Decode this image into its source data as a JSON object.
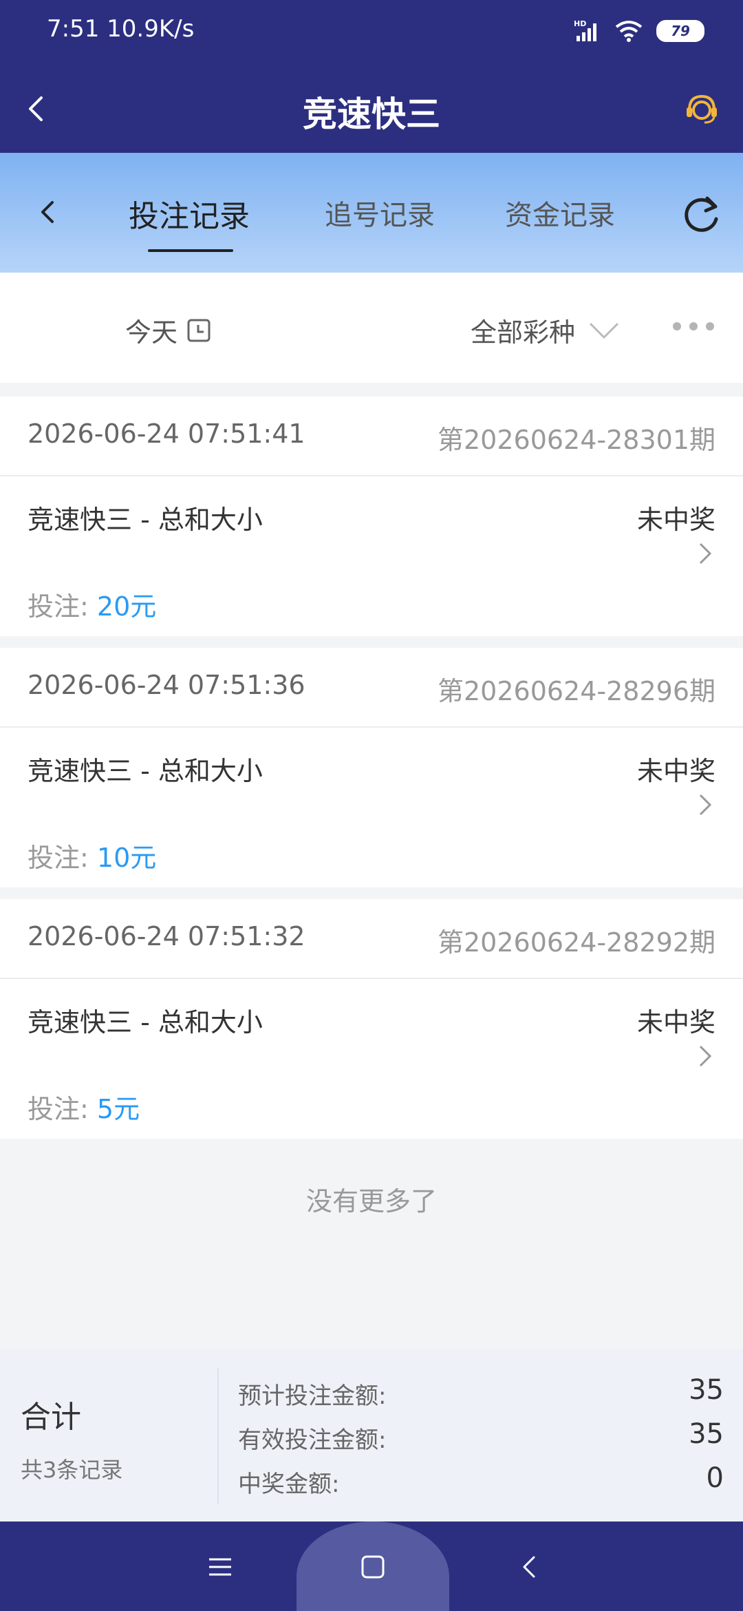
{
  "status_bar": {
    "time": "7:51",
    "speed": "10.9K/s",
    "battery": "79"
  },
  "header": {
    "title": "竞速快三"
  },
  "tabs": [
    {
      "label": "投注记录",
      "active": true
    },
    {
      "label": "追号记录",
      "active": false
    },
    {
      "label": "资金记录",
      "active": false
    }
  ],
  "filters": {
    "date": "今天",
    "lottery_type": "全部彩种"
  },
  "records": [
    {
      "time": "2026-06-24 07:51:41",
      "issue": "第20260624-28301期",
      "name": "竞速快三 - 总和大小",
      "status": "未中奖",
      "bet_label": "投注:",
      "bet_amount": "20元"
    },
    {
      "time": "2026-06-24 07:51:36",
      "issue": "第20260624-28296期",
      "name": "竞速快三 - 总和大小",
      "status": "未中奖",
      "bet_label": "投注:",
      "bet_amount": "10元"
    },
    {
      "time": "2026-06-24 07:51:32",
      "issue": "第20260624-28292期",
      "name": "竞速快三 - 总和大小",
      "status": "未中奖",
      "bet_label": "投注:",
      "bet_amount": "5元"
    }
  ],
  "no_more": "没有更多了",
  "summary": {
    "title": "合计",
    "count": "共3条记录",
    "rows": [
      {
        "label": "预计投注金额:",
        "value": "35"
      },
      {
        "label": "有效投注金额:",
        "value": "35"
      },
      {
        "label": "中奖金额:",
        "value": "0"
      }
    ]
  },
  "colors": {
    "header_bg": "#2c2f80",
    "accent_blue": "#2b9af3",
    "support_icon": "#f2b53a"
  }
}
